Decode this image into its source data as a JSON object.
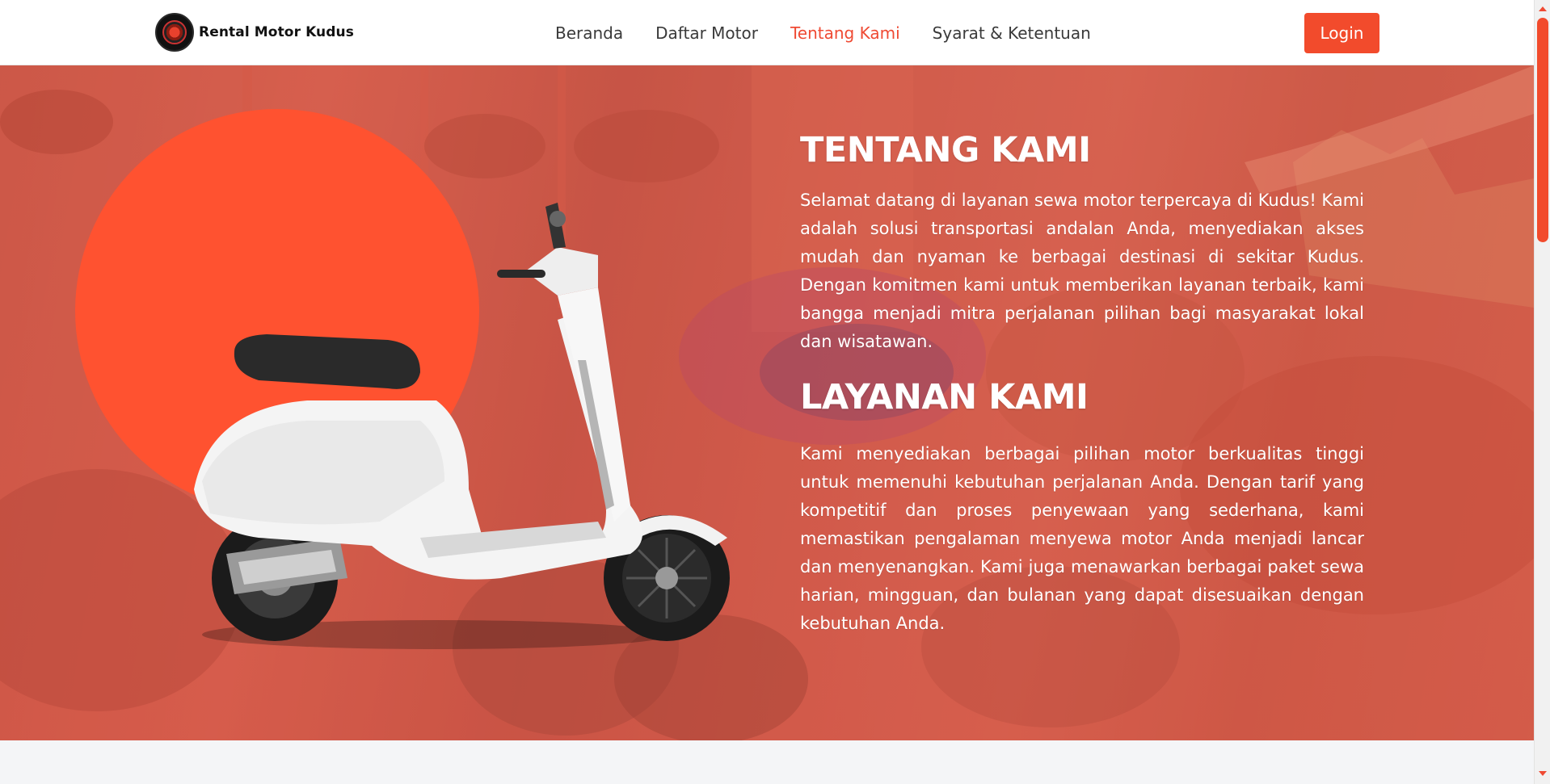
{
  "brand": {
    "name": "Rental Motor Kudus",
    "logo_icon": "motor-badge-logo"
  },
  "nav": {
    "items": [
      {
        "label": "Beranda",
        "active": false
      },
      {
        "label": "Daftar Motor",
        "active": false
      },
      {
        "label": "Tentang Kami",
        "active": true
      },
      {
        "label": "Syarat & Ketentuan",
        "active": false
      }
    ],
    "login_label": "Login"
  },
  "about": {
    "title": "TENTANG KAMI",
    "text": "Selamat datang di layanan sewa motor terpercaya di Kudus! Kami adalah solusi transportasi andalan Anda, menyediakan akses mudah dan nyaman ke berbagai destinasi di sekitar Kudus. Dengan komitmen kami untuk memberikan layanan terbaik, kami bangga menjadi mitra perjalanan pilihan bagi masyarakat lokal dan wisatawan."
  },
  "services": {
    "title": "LAYANAN KAMI",
    "text": "Kami menyediakan berbagai pilihan motor berkualitas tinggi untuk memenuhi kebutuhan perjalanan Anda. Dengan tarif yang kompetitif dan proses penyewaan yang sederhana, kami memastikan pengalaman menyewa motor Anda menjadi lancar dan menyenangkan. Kami juga menawarkan berbagai paket sewa harian, mingguan, dan bulanan yang dapat disesuaikan dengan kebutuhan Anda."
  },
  "hero_image": "white-scooter-image",
  "colors": {
    "accent": "#f24b2c",
    "nav_active": "#ef4a33",
    "overlay": "#ec5a46",
    "circle": "#ff5230"
  }
}
